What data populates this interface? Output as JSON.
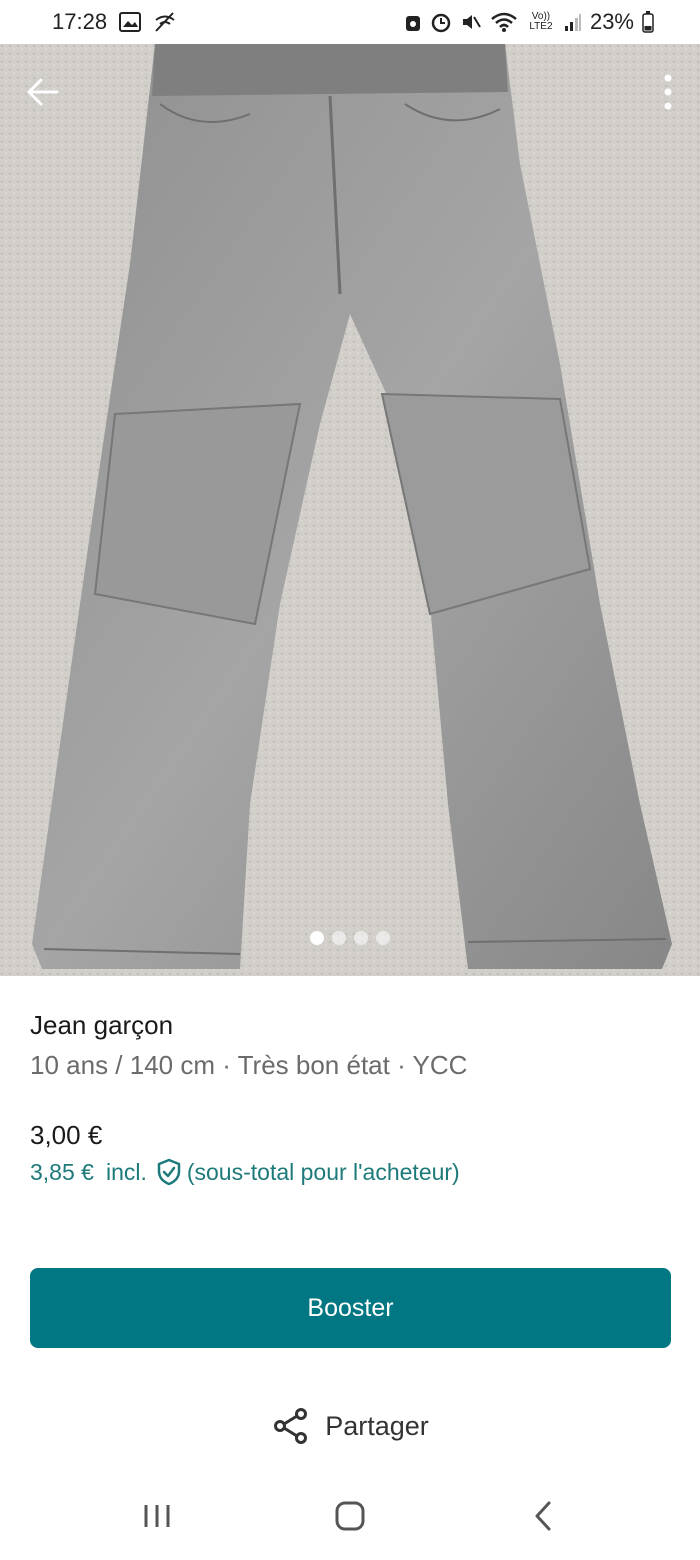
{
  "status_bar": {
    "time": "17:28",
    "network_label": "Vo)) LTE2",
    "battery_percent": "23%",
    "icons": [
      "gallery-icon",
      "wifi-off-call-icon",
      "alarm-icon",
      "clock-icon",
      "mute-icon",
      "wifi-icon",
      "signal-icon",
      "battery-icon"
    ]
  },
  "photo": {
    "count": 4,
    "active_index": 0
  },
  "item": {
    "title": "Jean garçon",
    "subtitle": "10 ans / 140 cm · Très bon état · YCC",
    "price": "3,00 €",
    "price_incl_amount": "3,85 €",
    "price_incl_label": "incl.",
    "price_incl_note": "(sous-total pour l'acheteur)"
  },
  "actions": {
    "booster_label": "Booster",
    "share_label": "Partager"
  },
  "colors": {
    "accent": "#007782",
    "accent_text": "#1e7a7a"
  }
}
